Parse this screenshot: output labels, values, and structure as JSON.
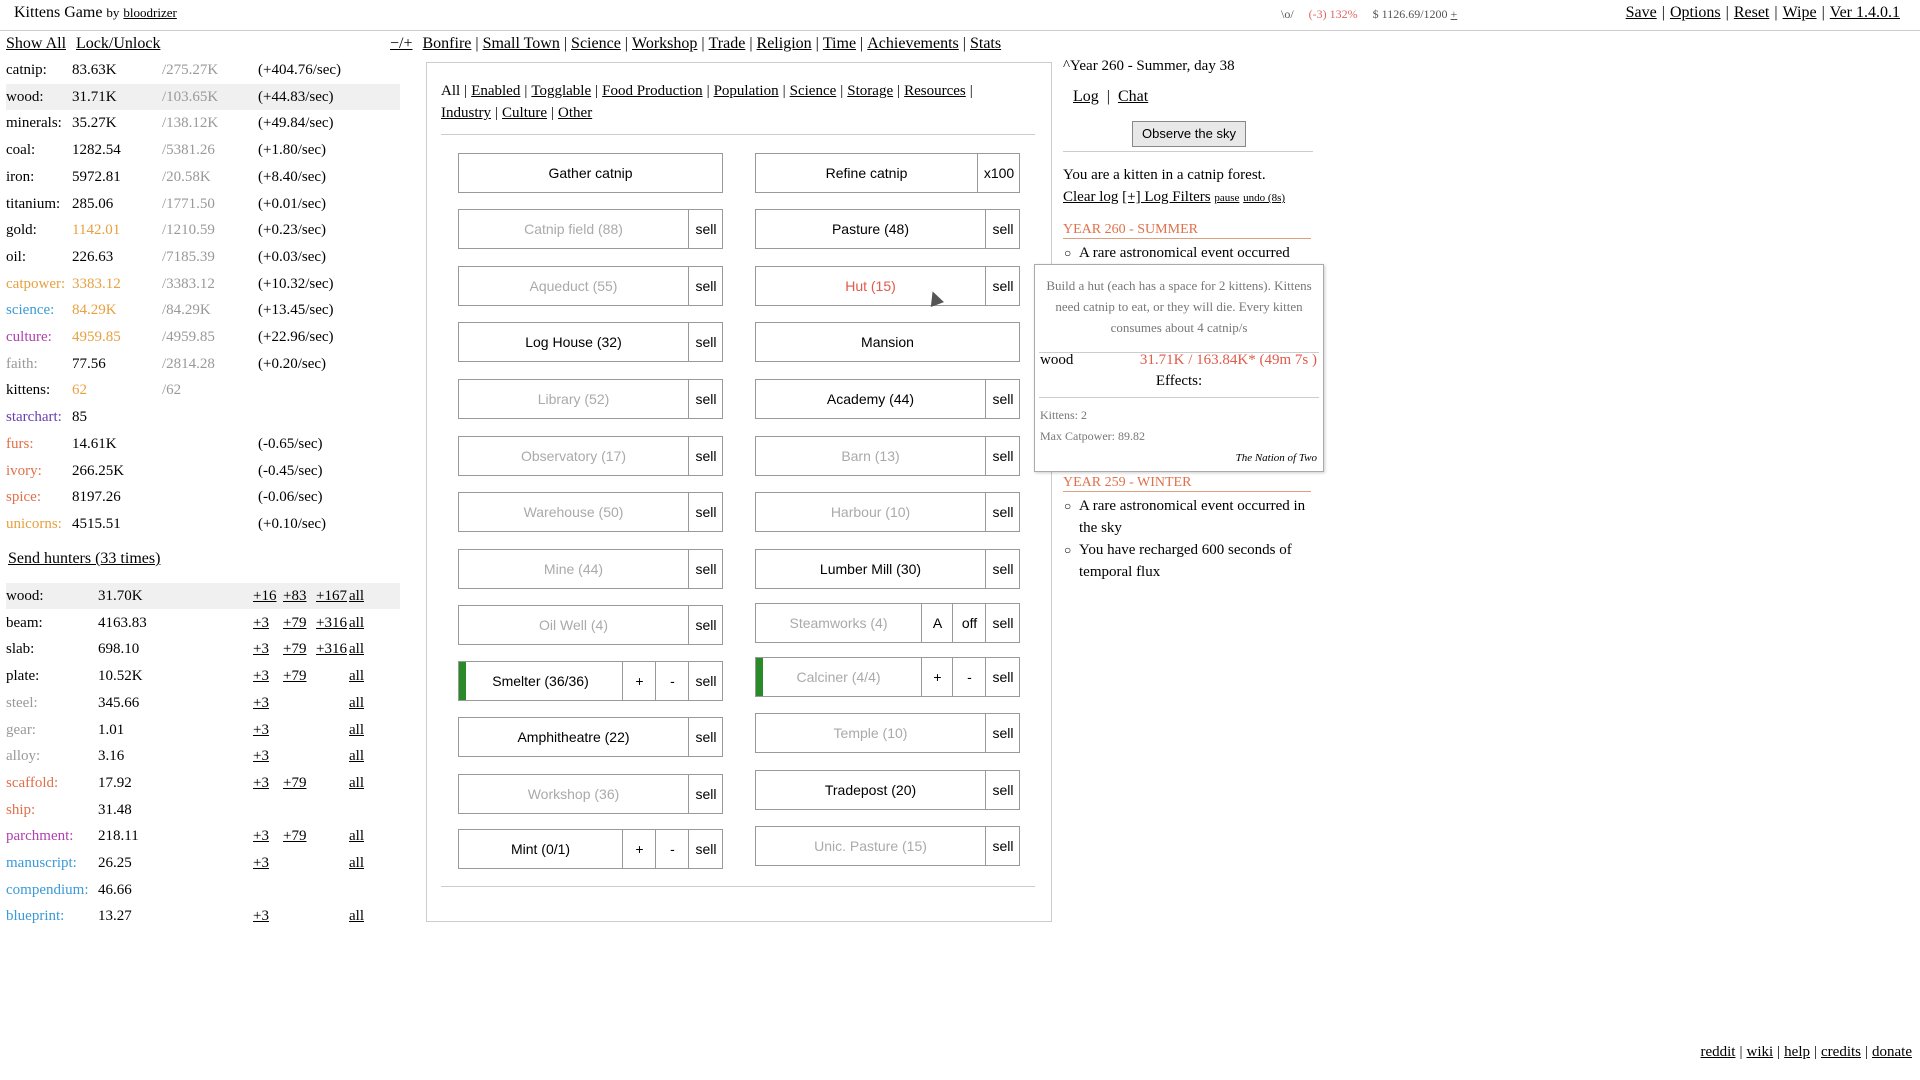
{
  "header": {
    "title": "Kittens Game",
    "by_label": "by",
    "author": "bloodrizer",
    "status_face": "\\o/",
    "status_happiness": "(-3) 132%",
    "status_money": "$ 1126.69/1200",
    "status_plus": "+",
    "menu": [
      "Save",
      "Options",
      "Reset",
      "Wipe",
      "Ver 1.4.0.1"
    ]
  },
  "left": {
    "show_all": "Show All",
    "lock_unlock": "Lock/Unlock",
    "resources": [
      {
        "name": "catnip:",
        "amount": "83.63K",
        "max": "/275.27K",
        "rate": "(+404.76/sec)",
        "color": "#000000"
      },
      {
        "name": "wood:",
        "amount": "31.71K",
        "max": "/103.65K",
        "rate": "(+44.83/sec)",
        "color": "#000000"
      },
      {
        "name": "minerals:",
        "amount": "35.27K",
        "max": "/138.12K",
        "rate": "(+49.84/sec)",
        "color": "#000000"
      },
      {
        "name": "coal:",
        "amount": "1282.54",
        "max": "/5381.26",
        "rate": "(+1.80/sec)",
        "color": "#000000"
      },
      {
        "name": "iron:",
        "amount": "5972.81",
        "max": "/20.58K",
        "rate": "(+8.40/sec)",
        "color": "#000000"
      },
      {
        "name": "titanium:",
        "amount": "285.06",
        "max": "/1771.50",
        "rate": "(+0.01/sec)",
        "color": "#000000"
      },
      {
        "name": "gold:",
        "amount": "1142.01",
        "max": "/1210.59",
        "rate": "(+0.23/sec)",
        "color": "#000000",
        "amount_color": "#e8a040"
      },
      {
        "name": "oil:",
        "amount": "226.63",
        "max": "/7185.39",
        "rate": "(+0.03/sec)",
        "color": "#000000"
      },
      {
        "name": "catpower:",
        "amount": "3383.12",
        "max": "/3383.12",
        "rate": "(+10.32/sec)",
        "color": "#e8a040",
        "amount_color": "#e8a040"
      },
      {
        "name": "science:",
        "amount": "84.29K",
        "max": "/84.29K",
        "rate": "(+13.45/sec)",
        "color": "#3a9ad9",
        "amount_color": "#e8a040"
      },
      {
        "name": "culture:",
        "amount": "4959.85",
        "max": "/4959.85",
        "rate": "(+22.96/sec)",
        "color": "#b040b0",
        "amount_color": "#e8a040"
      },
      {
        "name": "faith:",
        "amount": "77.56",
        "max": "/2814.28",
        "rate": "(+0.20/sec)",
        "color": "#999999"
      },
      {
        "name": "kittens:",
        "amount": "62",
        "max": "/62",
        "rate": "",
        "color": "#000000",
        "amount_color": "#e8a040"
      },
      {
        "name": "starchart:",
        "amount": "85",
        "max": "",
        "rate": "",
        "color": "#6a40b0"
      },
      {
        "name": "furs:",
        "amount": "14.61K",
        "max": "",
        "rate": "(-0.65/sec)",
        "color": "#e0704a"
      },
      {
        "name": "ivory:",
        "amount": "266.25K",
        "max": "",
        "rate": "(-0.45/sec)",
        "color": "#e0704a"
      },
      {
        "name": "spice:",
        "amount": "8197.26",
        "max": "",
        "rate": "(-0.06/sec)",
        "color": "#e0704a"
      },
      {
        "name": "unicorns:",
        "amount": "4515.51",
        "max": "",
        "rate": "(+0.10/sec)",
        "color": "#e8a040"
      }
    ],
    "send_hunters": "Send hunters (33 times)",
    "crafts": [
      {
        "name": "wood:",
        "amount": "31.70K",
        "c1": "+16",
        "c2": "+83",
        "c3": "+167",
        "c4": "all",
        "color": "#000000"
      },
      {
        "name": "beam:",
        "amount": "4163.83",
        "c1": "+3",
        "c2": "+79",
        "c3": "+316",
        "c4": "all",
        "color": "#000000"
      },
      {
        "name": "slab:",
        "amount": "698.10",
        "c1": "+3",
        "c2": "+79",
        "c3": "+316",
        "c4": "all",
        "color": "#000000"
      },
      {
        "name": "plate:",
        "amount": "10.52K",
        "c1": "+3",
        "c2": "+79",
        "c3": "",
        "c4": "all",
        "color": "#000000"
      },
      {
        "name": "steel:",
        "amount": "345.66",
        "c1": "+3",
        "c2": "",
        "c3": "",
        "c4": "all",
        "color": "#999999"
      },
      {
        "name": "gear:",
        "amount": "1.01",
        "c1": "+3",
        "c2": "",
        "c3": "",
        "c4": "all",
        "color": "#999999"
      },
      {
        "name": "alloy:",
        "amount": "3.16",
        "c1": "+3",
        "c2": "",
        "c3": "",
        "c4": "all",
        "color": "#999999"
      },
      {
        "name": "scaffold:",
        "amount": "17.92",
        "c1": "+3",
        "c2": "+79",
        "c3": "",
        "c4": "all",
        "color": "#e0704a"
      },
      {
        "name": "ship:",
        "amount": "31.48",
        "c1": "",
        "c2": "",
        "c3": "",
        "c4": "",
        "color": "#e0704a"
      },
      {
        "name": "parchment:",
        "amount": "218.11",
        "c1": "+3",
        "c2": "+79",
        "c3": "",
        "c4": "all",
        "color": "#b040b0"
      },
      {
        "name": "manuscript:",
        "amount": "26.25",
        "c1": "+3",
        "c2": "",
        "c3": "",
        "c4": "all",
        "color": "#3a9ad9"
      },
      {
        "name": "compendium:",
        "amount": "46.66",
        "c1": "",
        "c2": "",
        "c3": "",
        "c4": "",
        "color": "#3a9ad9"
      },
      {
        "name": "blueprint:",
        "amount": "13.27",
        "c1": "+3",
        "c2": "",
        "c3": "",
        "c4": "all",
        "color": "#3a9ad9"
      }
    ]
  },
  "tabs": {
    "toggle": "−/+",
    "items": [
      "Bonfire",
      "Small Town",
      "Science",
      "Workshop",
      "Trade",
      "Religion",
      "Time",
      "Achievements",
      "Stats"
    ]
  },
  "filters": {
    "row1": [
      "All",
      "Enabled",
      "Togglable",
      "Food Production",
      "Population",
      "Science",
      "Storage",
      "Resources"
    ],
    "row2": [
      "Industry",
      "Culture",
      "Other"
    ]
  },
  "buildings": {
    "gather": "Gather catnip",
    "refine": "Refine catnip",
    "refine_x": "x100",
    "sell": "sell",
    "plus": "+",
    "minus": "-",
    "a": "A",
    "off": "off",
    "catnip_field": "Catnip field (88)",
    "pasture": "Pasture (48)",
    "aqueduct": "Aqueduct (55)",
    "hut": "Hut (15)",
    "log_house": "Log House (32)",
    "mansion": "Mansion",
    "library": "Library (52)",
    "academy": "Academy (44)",
    "observatory": "Observatory (17)",
    "barn": "Barn (13)",
    "warehouse": "Warehouse (50)",
    "harbour": "Harbour (10)",
    "mine": "Mine (44)",
    "lumber_mill": "Lumber Mill (30)",
    "oil_well": "Oil Well (4)",
    "steamworks": "Steamworks (4)",
    "smelter": "Smelter (36/36)",
    "calciner": "Calciner (4/4)",
    "amphitheatre": "Amphitheatre (22)",
    "temple": "Temple (10)",
    "workshop": "Workshop (36)",
    "tradepost": "Tradepost (20)",
    "mint": "Mint (0/1)",
    "unic_pasture": "Unic. Pasture (15)"
  },
  "log": {
    "calendar": "Year 260 - Summer, day 38",
    "calendar_arrow": "^",
    "log_link": "Log",
    "chat_link": "Chat",
    "observe": "Observe the sky",
    "intro": "You are a kitten in a catnip forest.",
    "clear_log": "Clear log",
    "log_filters": "[+] Log Filters",
    "pause": "pause",
    "undo": "undo (8s)",
    "head1": "YEAR 260 - SUMMER",
    "item1": "A rare astronomical event occurred",
    "head2": "YEAR 259 - WINTER",
    "item2": "A rare astronomical event occurred in the sky",
    "item3": "You have recharged 600 seconds of temporal flux"
  },
  "tooltip": {
    "desc": "Build a hut (each has a space for 2 kittens). Kittens need catnip to eat, or they will die. Every kitten consumes about 4 catnip/s",
    "price_name": "wood",
    "price_value": "31.71K / 163.84K* (49m 7s )",
    "effects": "Effects:",
    "kittens": "Kittens: 2",
    "catpower": "Max Catpower: 89.82",
    "flavor": "The Nation of Two"
  },
  "footer": [
    "reddit",
    "wiki",
    "help",
    "credits",
    "donate"
  ]
}
